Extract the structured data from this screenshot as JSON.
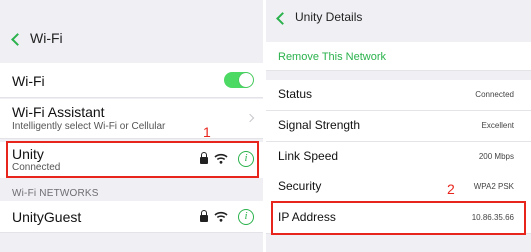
{
  "colors": {
    "accent": "#2bb24c",
    "toggle_on": "#4cd964",
    "highlight": "#e8251c",
    "background": "#efeff4"
  },
  "wifi_screen": {
    "title": "Wi-Fi",
    "wifi_row": {
      "label": "Wi-Fi",
      "toggle_on": true
    },
    "assistant_row": {
      "label": "Wi-Fi Assistant",
      "subtitle": "Intelligently select Wi-Fi or Cellular"
    },
    "connected_network": {
      "name": "Unity",
      "status": "Connected",
      "icons": [
        "lock-icon",
        "wifi-icon",
        "info-icon"
      ]
    },
    "section_header": "Wi-Fi NETWORKS",
    "networks": [
      {
        "name": "UnityGuest",
        "icons": [
          "lock-icon",
          "wifi-icon",
          "info-icon"
        ]
      }
    ],
    "callout": "1"
  },
  "details_screen": {
    "title": "Unity Details",
    "remove_network": "Remove This Network",
    "rows": [
      {
        "label": "Status",
        "value": "Connected"
      },
      {
        "label": "Signal Strength",
        "value": "Excellent"
      },
      {
        "label": "Link Speed",
        "value": "200 Mbps"
      },
      {
        "label": "Security",
        "value": "WPA2 PSK"
      },
      {
        "label": "IP Address",
        "value": "10.86.35.66"
      }
    ],
    "callout": "2"
  }
}
